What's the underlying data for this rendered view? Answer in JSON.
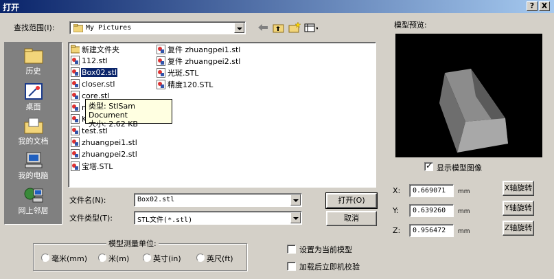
{
  "dialog": {
    "title": "打开",
    "help_label": "?",
    "close_label": "X"
  },
  "lookin": {
    "label": "查找范围(I):",
    "value": "My Pictures"
  },
  "places": [
    {
      "label": "历史",
      "icon": "history-icon"
    },
    {
      "label": "桌面",
      "icon": "desktop-icon"
    },
    {
      "label": "我的文档",
      "icon": "my-documents-icon"
    },
    {
      "label": "我的电脑",
      "icon": "my-computer-icon"
    },
    {
      "label": "网上邻居",
      "icon": "network-places-icon"
    }
  ],
  "files": {
    "col1": [
      {
        "name": "新建文件夹",
        "type": "folder"
      },
      {
        "name": "112.stl",
        "type": "stl"
      },
      {
        "name": "Box02.stl",
        "type": "stl",
        "selected": true
      },
      {
        "name": "closer.stl",
        "type": "stl"
      },
      {
        "name": "core.stl",
        "type": "stl"
      },
      {
        "name": "m",
        "type": "stl"
      },
      {
        "name": "K",
        "type": "stl"
      },
      {
        "name": "test.stl",
        "type": "stl"
      },
      {
        "name": "zhuangpei1.stl",
        "type": "stl"
      },
      {
        "name": "zhuangpei2.stl",
        "type": "stl"
      },
      {
        "name": "宝塔.STL",
        "type": "stl"
      }
    ],
    "col2": [
      {
        "name": "复件 zhuangpei1.stl",
        "type": "stl"
      },
      {
        "name": "复件 zhuangpei2.stl",
        "type": "stl"
      },
      {
        "name": "光斑.STL",
        "type": "stl"
      },
      {
        "name": "精度120.STL",
        "type": "stl"
      }
    ]
  },
  "tooltip": {
    "line1": "类型: StlSam Document",
    "line2": "大小: 2.62 KB"
  },
  "filename": {
    "label": "文件名(N):",
    "value": "Box02.stl"
  },
  "filetype": {
    "label": "文件类型(T):",
    "value": "STL文件(*.stl)"
  },
  "buttons": {
    "open": "打开(O)",
    "cancel": "取消"
  },
  "preview": {
    "label": "模型预览:",
    "show_image_label": "显示模型图像",
    "show_image_checked": true
  },
  "coords": [
    {
      "axis": "X:",
      "value": "0.669071",
      "unit": "mm",
      "rotate_label": "X轴旋转"
    },
    {
      "axis": "Y:",
      "value": "0.639260",
      "unit": "mm",
      "rotate_label": "Y轴旋转"
    },
    {
      "axis": "Z:",
      "value": "0.956472",
      "unit": "mm",
      "rotate_label": "Z轴旋转"
    }
  ],
  "units": {
    "label": "模型测量单位:",
    "options": [
      "毫米(mm)",
      "米(m)",
      "英寸(in)",
      "英尺(ft)"
    ]
  },
  "options": {
    "set_current": "设置为当前模型",
    "verify_after_load": "加载后立即机校验"
  },
  "colors": {
    "titlebar": "#0a246a",
    "selection": "#0a246a",
    "tooltip_bg": "#ffffe1"
  }
}
